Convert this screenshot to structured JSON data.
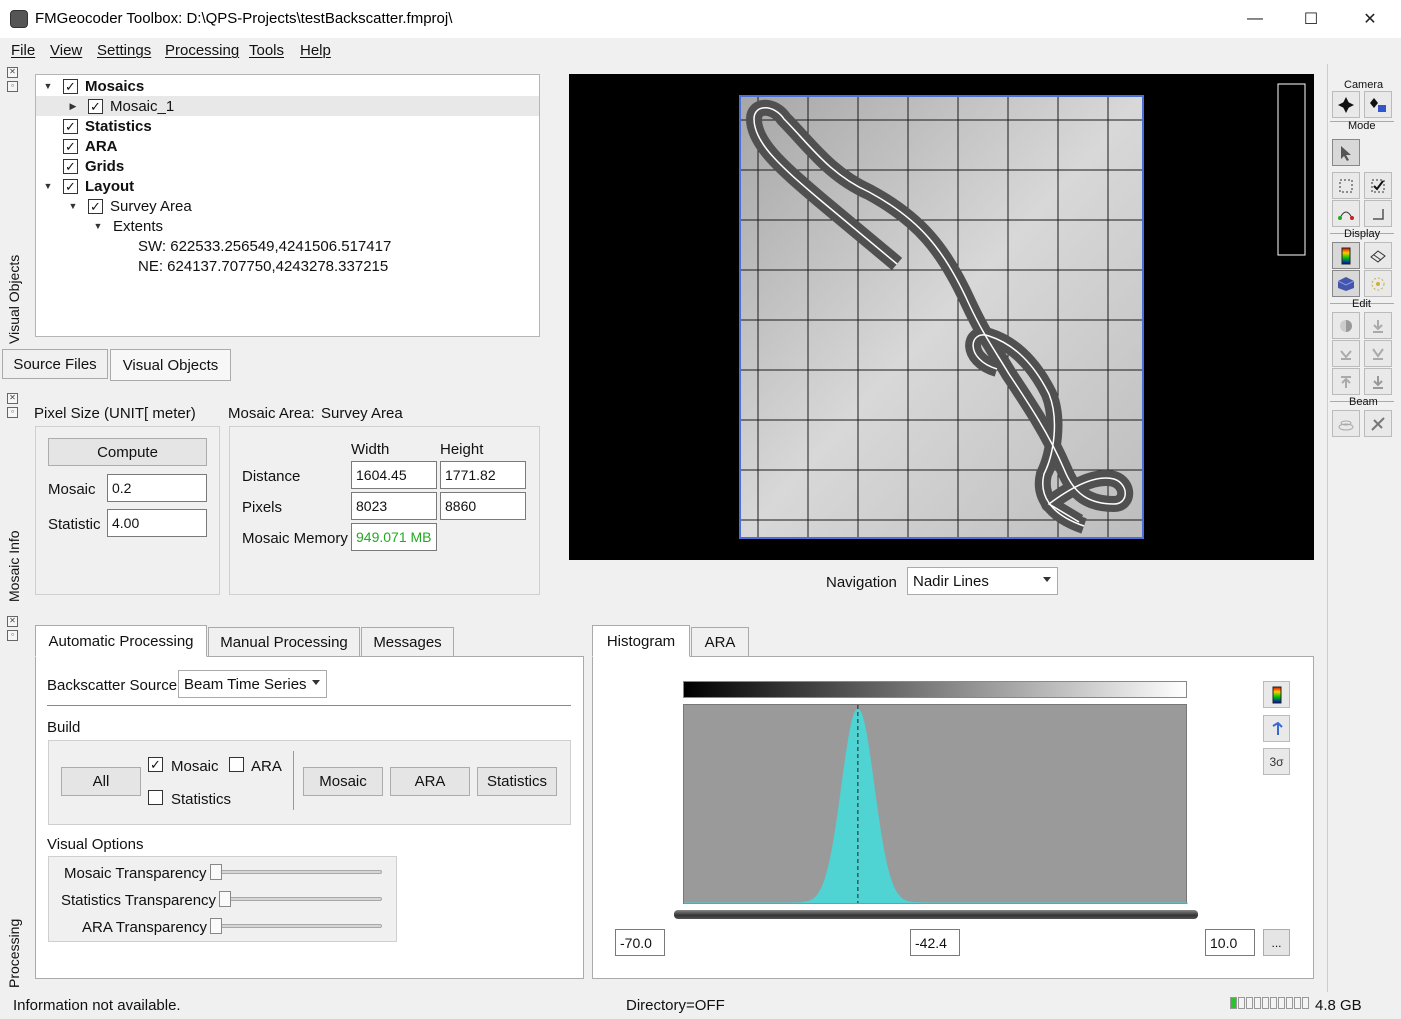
{
  "window": {
    "title": "FMGeocoder Toolbox: D:\\QPS-Projects\\testBackscatter.fmproj\\",
    "min": "—",
    "max": "☐",
    "close": "✕"
  },
  "menu": [
    "File",
    "View",
    "Settings",
    "Processing",
    "Tools",
    "Help"
  ],
  "dock_titles": {
    "visual_objects": "Visual Objects",
    "mosaic_info": "Mosaic Info",
    "processing": "Processing"
  },
  "tree": {
    "mosaics": "Mosaics",
    "mosaic_1": "Mosaic_1",
    "statistics": "Statistics",
    "ara": "ARA",
    "grids": "Grids",
    "layout": "Layout",
    "survey_area": "Survey Area",
    "extents": "Extents",
    "sw": "SW: 622533.256549,4241506.517417",
    "ne": "NE: 624137.707750,4243278.337215"
  },
  "left_tabs": [
    "Source Files",
    "Visual Objects"
  ],
  "mosaic_info": {
    "pixel_size_label": "Pixel Size (UNIT[ meter)",
    "compute_label": "Compute",
    "mosaic_label": "Mosaic",
    "mosaic_value": "0.2",
    "statistic_label": "Statistic",
    "statistic_value": "4.00",
    "area_label": "Mosaic Area:",
    "area_value": "Survey Area",
    "width_label": "Width",
    "height_label": "Height",
    "distance_label": "Distance",
    "distance_w": "1604.45",
    "distance_h": "1771.82",
    "pixels_label": "Pixels",
    "pixels_w": "8023",
    "pixels_h": "8860",
    "memory_label": "Mosaic Memory",
    "memory_value": "949.071 MB",
    "memory_color": "#22aa22"
  },
  "navigation": {
    "label": "Navigation",
    "value": "Nadir Lines"
  },
  "processing_tabs": [
    "Automatic Processing",
    "Manual Processing",
    "Messages"
  ],
  "auto": {
    "backscatter_label": "Backscatter Source",
    "backscatter_value": "Beam Time Series",
    "build_label": "Build",
    "all_label": "All",
    "chk_mosaic": "Mosaic",
    "chk_ara": "ARA",
    "chk_statistics": "Statistics",
    "btn_mosaic": "Mosaic",
    "btn_ara": "ARA",
    "btn_statistics": "Statistics",
    "visual_options_label": "Visual Options",
    "mosaic_transparency": "Mosaic Transparency",
    "statistics_transparency": "Statistics Transparency",
    "ara_transparency": "ARA Transparency"
  },
  "histogram_tabs": [
    "Histogram",
    "ARA"
  ],
  "histogram": {
    "min": "-70.0",
    "mid": "-42.4",
    "max": "10.0",
    "more": "...",
    "sigma_label": "3σ",
    "fill_color": "#4fd3d3"
  },
  "toolbar": {
    "camera": "Camera",
    "mode": "Mode",
    "display": "Display",
    "edit": "Edit",
    "beam": "Beam"
  },
  "status": {
    "info": "Information not available.",
    "directory": "Directory=OFF",
    "memory": "4.8 GB",
    "memory_fraction": 0.1
  }
}
